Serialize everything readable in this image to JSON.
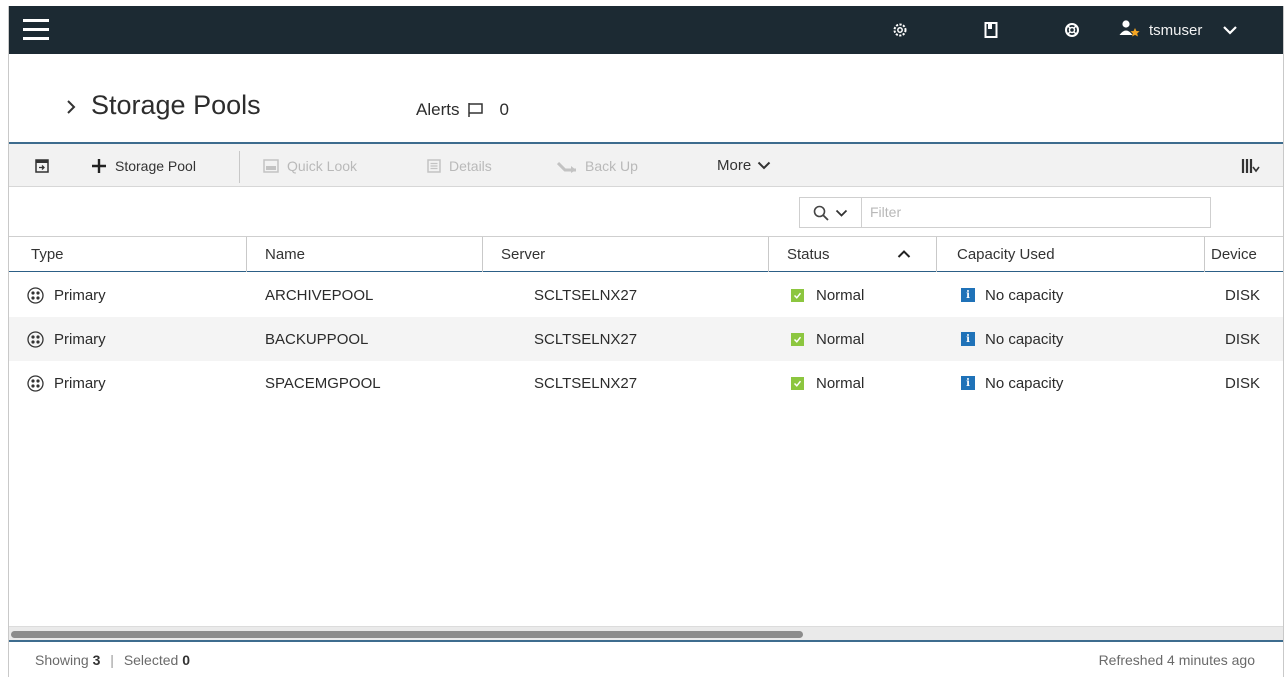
{
  "topbar": {
    "username": "tsmuser",
    "icons": [
      "menu-icon",
      "settings-icon",
      "bookmark-icon",
      "help-icon",
      "user-icon",
      "chevron-down-icon"
    ]
  },
  "page": {
    "title": "Storage Pools",
    "alerts_label": "Alerts",
    "alerts_count": "0"
  },
  "toolbar": {
    "add_label": "Storage Pool",
    "quick_look_label": "Quick Look",
    "details_label": "Details",
    "back_up_label": "Back Up",
    "more_label": "More"
  },
  "filter": {
    "placeholder": "Filter"
  },
  "table": {
    "columns": [
      "Type",
      "Name",
      "Server",
      "Status",
      "Capacity Used",
      "Device"
    ],
    "sort_column": "Status",
    "rows": [
      {
        "type": "Primary",
        "name": "ARCHIVEPOOL",
        "server": "SCLTSELNX27",
        "status": "Normal",
        "capacity": "No capacity",
        "device": "DISK"
      },
      {
        "type": "Primary",
        "name": "BACKUPPOOL",
        "server": "SCLTSELNX27",
        "status": "Normal",
        "capacity": "No capacity",
        "device": "DISK"
      },
      {
        "type": "Primary",
        "name": "SPACEMGPOOL",
        "server": "SCLTSELNX27",
        "status": "Normal",
        "capacity": "No capacity",
        "device": "DISK"
      }
    ]
  },
  "footer": {
    "showing_label": "Showing",
    "showing_count": "3",
    "selected_label": "Selected",
    "selected_count": "0",
    "refreshed": "Refreshed 4 minutes ago"
  },
  "colors": {
    "topbar_bg": "#1c2a33",
    "accent_border": "#3d6c8e",
    "status_ok": "#8cc63f",
    "info_blue": "#1f72b8"
  }
}
